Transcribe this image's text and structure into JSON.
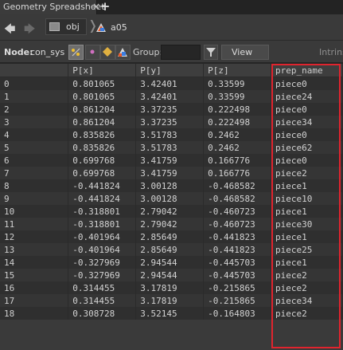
{
  "tab": {
    "title": "Geometry Spreadsheet",
    "close_glyph": "×",
    "add_glyph": "+"
  },
  "path": {
    "back_glyph": "🡄",
    "forward_glyph": "🡆",
    "crumb1": "obj",
    "separator": "❭",
    "crumb2": "a05"
  },
  "toolbar": {
    "node_label": "Node:",
    "node_value": "con_sys",
    "group_label": "Group:",
    "group_value": "",
    "view_label": "View",
    "intrinsic_label": "Intrins"
  },
  "table": {
    "columns": [
      "",
      "P[x]",
      "P[y]",
      "P[z]",
      "prep_name"
    ],
    "rows": [
      [
        "0",
        "0.801065",
        "3.42401",
        "0.33599",
        "piece0"
      ],
      [
        "1",
        "0.801065",
        "3.42401",
        "0.33599",
        "piece24"
      ],
      [
        "2",
        "0.861204",
        "3.37235",
        "0.222498",
        "piece0"
      ],
      [
        "3",
        "0.861204",
        "3.37235",
        "0.222498",
        "piece34"
      ],
      [
        "4",
        "0.835826",
        "3.51783",
        "0.2462",
        "piece0"
      ],
      [
        "5",
        "0.835826",
        "3.51783",
        "0.2462",
        "piece62"
      ],
      [
        "6",
        "0.699768",
        "3.41759",
        "0.166776",
        "piece0"
      ],
      [
        "7",
        "0.699768",
        "3.41759",
        "0.166776",
        "piece2"
      ],
      [
        "8",
        "-0.441824",
        "3.00128",
        "-0.468582",
        "piece1"
      ],
      [
        "9",
        "-0.441824",
        "3.00128",
        "-0.468582",
        "piece10"
      ],
      [
        "10",
        "-0.318801",
        "2.79042",
        "-0.460723",
        "piece1"
      ],
      [
        "11",
        "-0.318801",
        "2.79042",
        "-0.460723",
        "piece30"
      ],
      [
        "12",
        "-0.401964",
        "2.85649",
        "-0.441823",
        "piece1"
      ],
      [
        "13",
        "-0.401964",
        "2.85649",
        "-0.441823",
        "piece25"
      ],
      [
        "14",
        "-0.327969",
        "2.94544",
        "-0.445703",
        "piece1"
      ],
      [
        "15",
        "-0.327969",
        "2.94544",
        "-0.445703",
        "piece2"
      ],
      [
        "16",
        "0.314455",
        "3.17819",
        "-0.215865",
        "piece2"
      ],
      [
        "17",
        "0.314455",
        "3.17819",
        "-0.215865",
        "piece34"
      ],
      [
        "18",
        "0.308728",
        "3.52145",
        "-0.164803",
        "piece2"
      ]
    ]
  },
  "colors": {
    "highlight": "#e0242e",
    "background": "#3a3a3a"
  }
}
